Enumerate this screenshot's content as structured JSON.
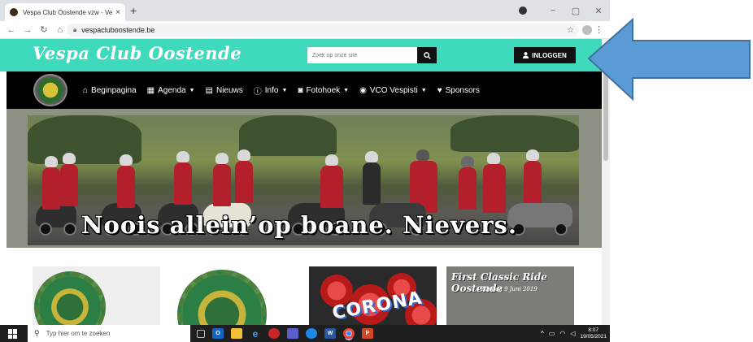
{
  "browser": {
    "tab_title": "Vespa Club Oostende vzw - Vesp",
    "tab_close": "×",
    "new_tab": "+",
    "window_controls": {
      "minimize": "−",
      "maximize": "▢",
      "close": "✕"
    },
    "nav": {
      "back": "←",
      "forward": "→",
      "reload": "↻",
      "home": "⌂"
    },
    "url": "vespacluboostende.be",
    "bookmark_star": "☆",
    "menu": "⋮"
  },
  "site": {
    "logo": "Vespa Club Oostende",
    "search_placeholder": "Zoek op onze site",
    "search_icon": "search-icon",
    "login_label": "INLOGGEN",
    "accent_color": "#3fd9bd",
    "nav_items": [
      {
        "label": "Beginpagina",
        "icon": "home-icon",
        "has_dropdown": false
      },
      {
        "label": "Agenda",
        "icon": "calendar-icon",
        "has_dropdown": true
      },
      {
        "label": "Nieuws",
        "icon": "newspaper-icon",
        "has_dropdown": false
      },
      {
        "label": "Info",
        "icon": "info-icon",
        "has_dropdown": true
      },
      {
        "label": "Fotohoek",
        "icon": "camera-icon",
        "has_dropdown": true
      },
      {
        "label": "VCO Vespisti",
        "icon": "map-pin-icon",
        "has_dropdown": true
      },
      {
        "label": "Sponsors",
        "icon": "heart-icon",
        "has_dropdown": false
      }
    ],
    "banner_text": "Noois allein’op boane. Nievers.",
    "cards": {
      "corona_text": "CORONA",
      "ride_title": "First Classic Ride Oostende",
      "ride_subtitle": "Zondag 9 Juni 2019"
    }
  },
  "taskbar": {
    "search_placeholder": "Typ hier om te zoeken",
    "time": "8:07",
    "date": "19/05/2021"
  }
}
